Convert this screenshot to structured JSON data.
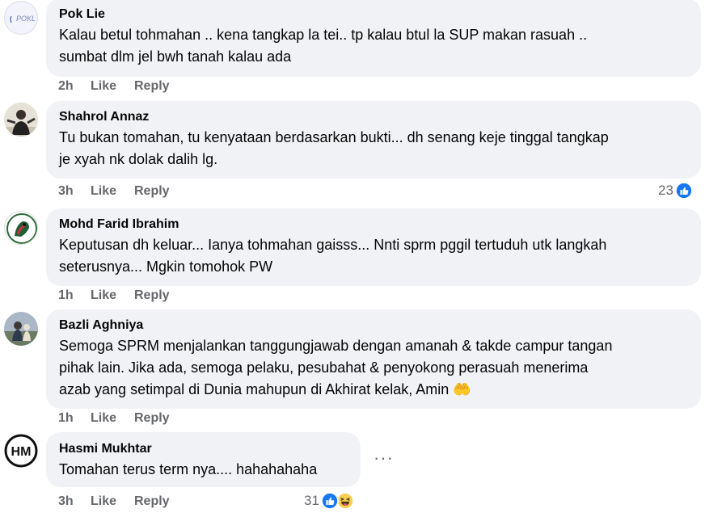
{
  "comments": [
    {
      "author": "Pok Lie",
      "avatar_text": "POKL",
      "text_lines": [
        "Kalau betul tohmahan .. kena tangkap la tei.. tp kalau btul la SUP makan rasuah ..",
        "sumbat dlm jel bwh tanah kalau ada"
      ],
      "time": "2h",
      "like_label": "Like",
      "reply_label": "Reply"
    },
    {
      "author": "Shahrol Annaz",
      "text_lines": [
        "Tu bukan tomahan, tu kenyataan berdasarkan bukti... dh senang keje tinggal tangkap",
        "je xyah nk dolak dalih lg."
      ],
      "time": "3h",
      "like_label": "Like",
      "reply_label": "Reply",
      "reaction_count": "23",
      "reaction_icons": [
        "like-reaction-icon"
      ]
    },
    {
      "author": "Mohd Farid Ibrahim",
      "text_lines": [
        "Keputusan dh keluar... Ianya tohmahan gaisss... Nnti sprm pggil tertuduh utk langkah",
        "seterusnya... Mgkin tomohok PW"
      ],
      "time": "1h",
      "like_label": "Like",
      "reply_label": "Reply"
    },
    {
      "author": "Bazli Aghniya",
      "text_lines": [
        "Semoga SPRM menjalankan tanggungjawab dengan amanah & takde campur tangan",
        "pihak lain. Jika ada, semoga pelaku, pesubahat & penyokong perasuah menerima",
        "azab yang setimpal di Dunia mahupun di Akhirat kelak, Amin"
      ],
      "emoji": "🤲",
      "time": "1h",
      "like_label": "Like",
      "reply_label": "Reply"
    },
    {
      "author": "Hasmi Mukhtar",
      "avatar_text": "HM",
      "text_lines": [
        "Tomahan terus term nya.... hahahahaha"
      ],
      "time": "3h",
      "like_label": "Like",
      "reply_label": "Reply",
      "reaction_count": "31",
      "reaction_icons": [
        "like-reaction-icon",
        "laughing-reaction-icon"
      ],
      "more_label": "···"
    }
  ],
  "colors": {
    "bubble_bg": "#f0f2f5",
    "meta_text": "#65676b",
    "like_blue": "#1877f2",
    "haha_yellow": "#f7d052"
  }
}
